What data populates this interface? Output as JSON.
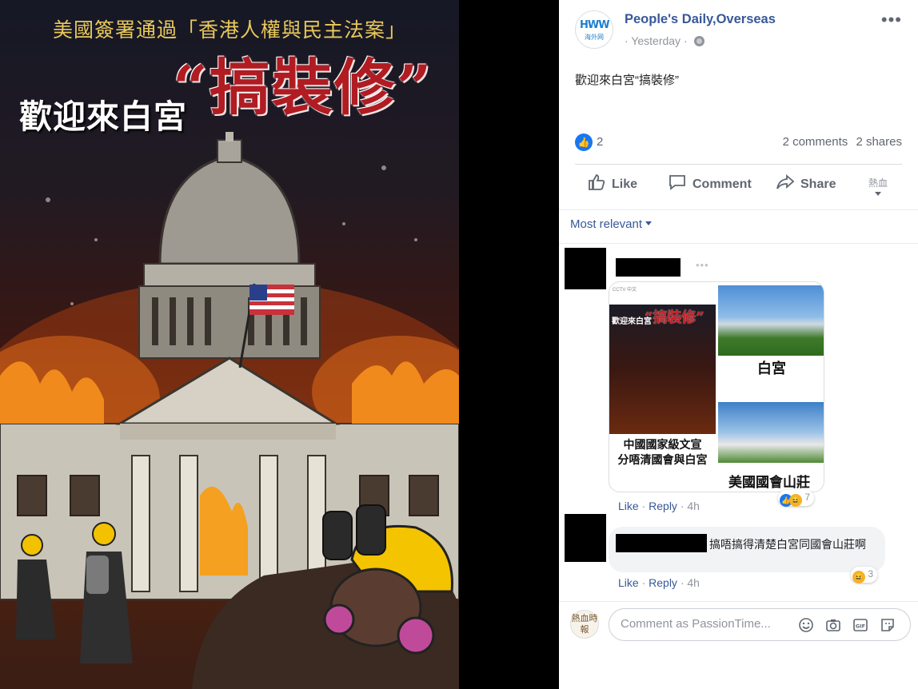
{
  "poster": {
    "top_line": "美國簽署通過「香港人權與民主法案」",
    "welcome_text": "歡迎來白宮",
    "highlight_text": "“搞裝修”"
  },
  "post": {
    "page_name": "People's Daily,Overseas",
    "avatar_logo": "HWW",
    "avatar_sub": "海外网",
    "timestamp": "Yesterday",
    "body": "歡迎來白宮“搞裝修”",
    "like_count": "2",
    "comments_count": "2 comments",
    "shares_count": "2 shares"
  },
  "actions": {
    "like": "Like",
    "comment": "Comment",
    "share": "Share",
    "switch_label": "熱血"
  },
  "comments_section": {
    "sort_label": "Most relevant",
    "comments": [
      {
        "image": {
          "header": "CCTV 中文",
          "poster_title": "歡迎來白宮",
          "poster_highlight": "“搞裝修”",
          "left_caption": "中國國家級文宣\n分唔清國會與白宮",
          "top_right_label": "白宮",
          "bottom_right_label": "美國國會山莊"
        },
        "like": "Like",
        "reply": "Reply",
        "time": "4h",
        "reaction_count": "7"
      },
      {
        "text": "搞唔搞得清楚白宮同國會山莊啊",
        "like": "Like",
        "reply": "Reply",
        "time": "4h",
        "reaction_count": "3"
      }
    ]
  },
  "composer": {
    "avatar_text": "熱血時報",
    "placeholder": "Comment as PassionTime..."
  },
  "colors": {
    "link_blue": "#385898",
    "facebook_blue": "#1877f2",
    "poster_red": "#b01c22",
    "poster_gold": "#e9c95a"
  }
}
